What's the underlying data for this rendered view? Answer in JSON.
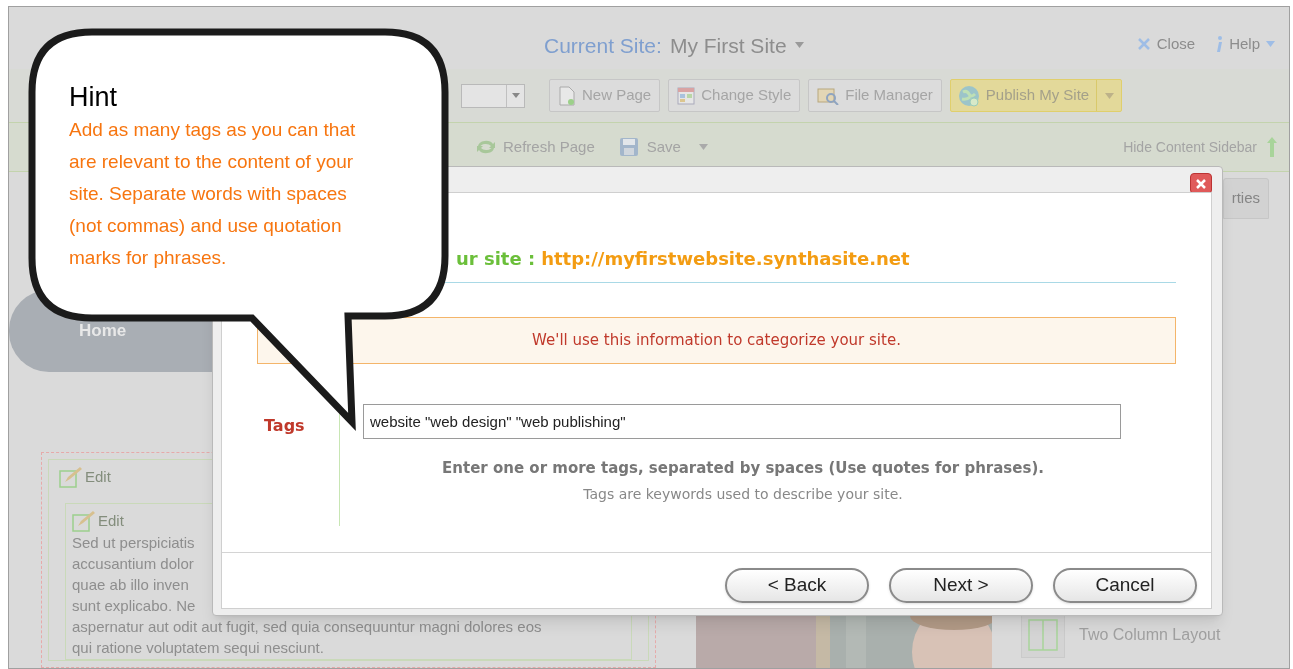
{
  "app": {
    "current_site_label": "Current Site:",
    "site_name": "My First Site",
    "close": "Close",
    "help": "Help"
  },
  "toolbar": {
    "buttons": [
      {
        "label": "New Page",
        "kind": "plain"
      },
      {
        "label": "Change Style",
        "kind": "plain"
      },
      {
        "label": "File Manager",
        "kind": "plain"
      },
      {
        "label": "Publish My Site",
        "kind": "publish"
      }
    ]
  },
  "action_bar": {
    "refresh": "Refresh Page",
    "save": "Save",
    "hide_sidebar": "Hide Content Sidebar"
  },
  "nav": {
    "home": "Home"
  },
  "content": {
    "edit_labels": [
      "Edit",
      "Edit"
    ],
    "paragraph_lines": [
      "Sed ut perspiciatis",
      "accusantium dolor",
      "quae ab illo inven",
      "sunt explicabo. Ne",
      "aspernatur aut odit aut fugit, sed quia consequuntur magni dolores eos",
      "qui ratione voluptatem sequi nesciunt."
    ]
  },
  "sidebar": {
    "tab": "rties",
    "layout_option": "Two Column Layout"
  },
  "dialog": {
    "heading_prefix": "ur site :",
    "site_url": "http://myfirstwebsite.synthasite.net",
    "info": "We'll use this information to categorize your site.",
    "field": {
      "label": "Tags",
      "value": "website \"web design\" \"web publishing\""
    },
    "hint": "Enter one or more tags, separated by spaces (Use quotes for phrases).",
    "note": "Tags are keywords used to describe your site.",
    "buttons": [
      {
        "label": "< Back"
      },
      {
        "label": "Next >"
      },
      {
        "label": "Cancel"
      }
    ]
  },
  "callout": {
    "title": "Hint",
    "text": "Add as many tags as you can that are relevant to the content of your site. Separate words with spaces (not commas) and use quotation marks for phrases."
  }
}
